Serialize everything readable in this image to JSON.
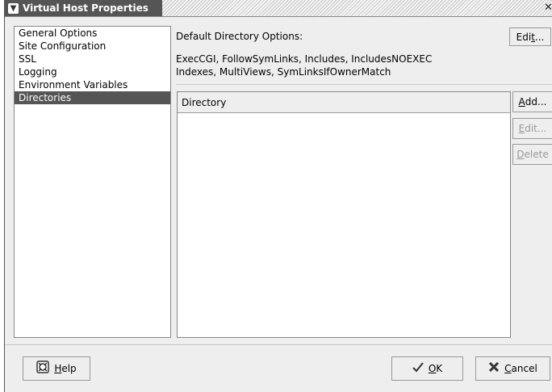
{
  "window": {
    "title": "Virtual Host Properties",
    "menu_icon": "chevron-down-icon",
    "close_glyph": "✕"
  },
  "nav": {
    "items": [
      {
        "label": "General Options"
      },
      {
        "label": "Site Configuration"
      },
      {
        "label": "SSL"
      },
      {
        "label": "Logging"
      },
      {
        "label": "Environment Variables"
      },
      {
        "label": "Directories",
        "selected": true
      }
    ]
  },
  "options": {
    "heading": "Default Directory Options:",
    "line1": "ExecCGI, FollowSymLinks, Includes, IncludesNOEXEC",
    "line2": "Indexes, MultiViews, SymLinksIfOwnerMatch",
    "edit_button": {
      "pre": "Edi",
      "mnemonic": "t",
      "post": "..."
    }
  },
  "directory_table": {
    "columns": [
      "Directory"
    ],
    "rows": []
  },
  "side_buttons": {
    "add": {
      "pre": "",
      "mnemonic": "A",
      "post": "dd..."
    },
    "edit": {
      "pre": "",
      "mnemonic": "E",
      "post": "dit...",
      "disabled": true
    },
    "delete": {
      "pre": "",
      "mnemonic": "D",
      "post": "elete",
      "disabled": true
    }
  },
  "footer": {
    "help": {
      "pre": "",
      "mnemonic": "H",
      "post": "elp",
      "icon": "help-icon"
    },
    "ok": {
      "pre": "",
      "mnemonic": "O",
      "post": "K",
      "icon": "checkmark-icon"
    },
    "cancel": {
      "pre": "",
      "mnemonic": "C",
      "post": "ancel",
      "icon": "cancel-x-icon"
    }
  },
  "colors": {
    "selected_bg": "#555555",
    "window_bg": "#eeeeee",
    "disabled_text": "#999999"
  }
}
